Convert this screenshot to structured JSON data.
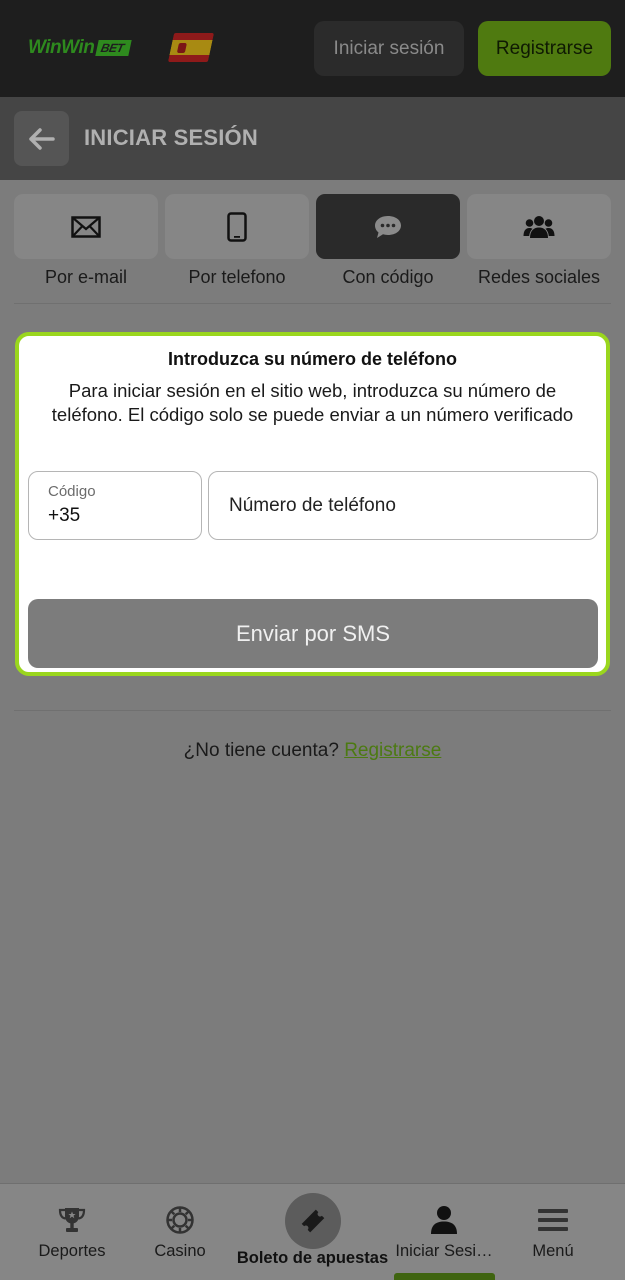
{
  "header": {
    "logo": {
      "part1": "WinWin",
      "part2": "BET"
    },
    "flag_icon": "spain-flag-icon",
    "login_label": "Iniciar sesión",
    "register_label": "Registrarse"
  },
  "subheader": {
    "back_icon": "arrow-left-icon",
    "title": "INICIAR SESIÓN"
  },
  "tabs": [
    {
      "label": "Por e-mail",
      "icon": "envelope-icon",
      "active": false
    },
    {
      "label": "Por telefono",
      "icon": "smartphone-icon",
      "active": false
    },
    {
      "label": "Con código",
      "icon": "chat-bubble-icon",
      "active": true
    },
    {
      "label": "Redes sociales",
      "icon": "users-icon",
      "active": false
    }
  ],
  "form": {
    "title": "Introduzca su número de teléfono",
    "description": "Para iniciar sesión en el sitio web, introduzca su número de teléfono. El código solo se puede enviar a un número verificado",
    "code_label": "Código",
    "code_value": "+35",
    "phone_placeholder": "Número de teléfono",
    "send_label": "Enviar por SMS"
  },
  "footer": {
    "no_account": "¿No tiene cuenta?",
    "register_link": "Registrarse"
  },
  "bottom_nav": [
    {
      "label": "Deportes",
      "icon": "trophy-icon"
    },
    {
      "label": "Casino",
      "icon": "casino-chip-icon"
    },
    {
      "label": "Boleto de apuestas",
      "icon": "ticket-icon"
    },
    {
      "label": "Iniciar Sesi…",
      "icon": "user-icon",
      "active": true
    },
    {
      "label": "Menú",
      "icon": "hamburger-menu-icon"
    }
  ],
  "colors": {
    "accent_green": "#9ad61e",
    "register_button": "#4f7a10",
    "overlay_bg": "#7c7c7c",
    "topbar_bg": "#1e1e1e"
  }
}
